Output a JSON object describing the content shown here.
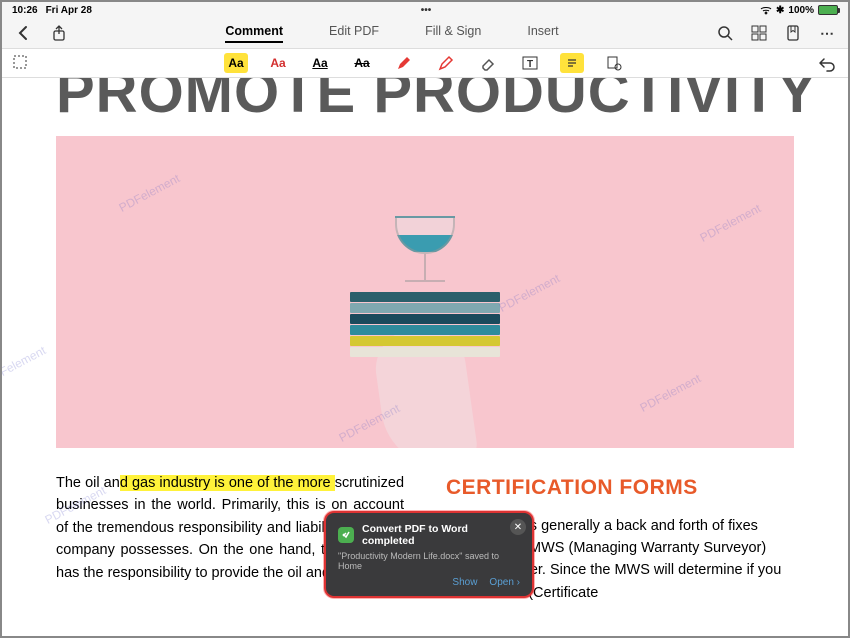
{
  "status": {
    "time": "10:26",
    "date": "Fri Apr 28",
    "center": "•••",
    "battery_pct": "100%"
  },
  "nav": {
    "tabs": {
      "comment": "Comment",
      "edit": "Edit PDF",
      "fill": "Fill & Sign",
      "insert": "Insert"
    }
  },
  "toolbar": {
    "aa": "Aa"
  },
  "doc": {
    "title": "PROMOTE PRODUCTIVITY",
    "watermark": "PDFelement",
    "left_text_pre": "The oil an",
    "left_hl1": "d gas industry is ",
    "left_hl2": "one of the more ",
    "left_text_post": "scrutinized businesses in the world. Primarily, this is on account of the tremendous responsibility and liability that each company possesses. On the one hand, the business has the responsibility to provide the oil and gas",
    "right_title": "CERTIFICATION FORMS",
    "right_text": "Certification is generally a back and forth of fixes between the MWS (Managing Warranty Surveyor) and the insurer. Since the MWS will determine if you have a COA (Certificate"
  },
  "toast": {
    "title": "Convert PDF to Word completed",
    "subtitle": "\"Productivity Modern Life.docx\" saved to Home",
    "show": "Show",
    "open": "Open"
  }
}
